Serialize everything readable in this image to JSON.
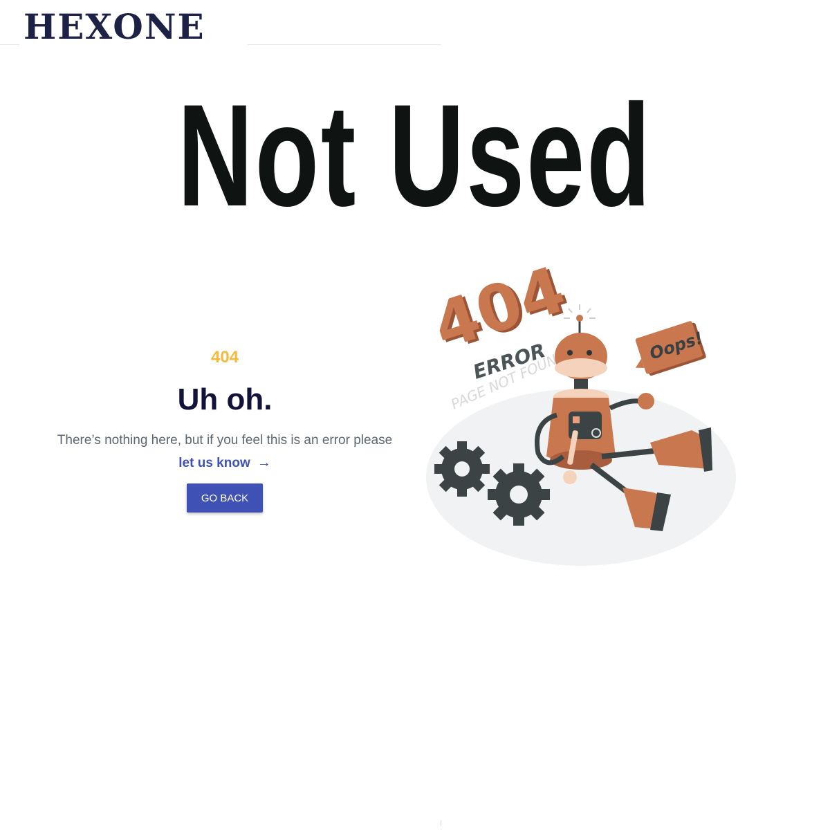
{
  "header": {
    "logo_text": "HEXONE"
  },
  "hero": {
    "title": "Not Used"
  },
  "error": {
    "code": "404",
    "heading": "Uh oh.",
    "message": "There’s nothing here, but if you feel this is an error please",
    "link_label": "let us know",
    "link_arrow": "→",
    "button_label": "GO BACK"
  },
  "illustration": {
    "number": "404",
    "error_label": "ERROR",
    "subtitle": "PAGE NOT FOUND",
    "speech": "Oops!"
  },
  "colors": {
    "accent": "#3f51b5",
    "code": "#f6b93b",
    "heading": "#12123a",
    "robot": "#c8774f",
    "gear": "#3c4345"
  }
}
